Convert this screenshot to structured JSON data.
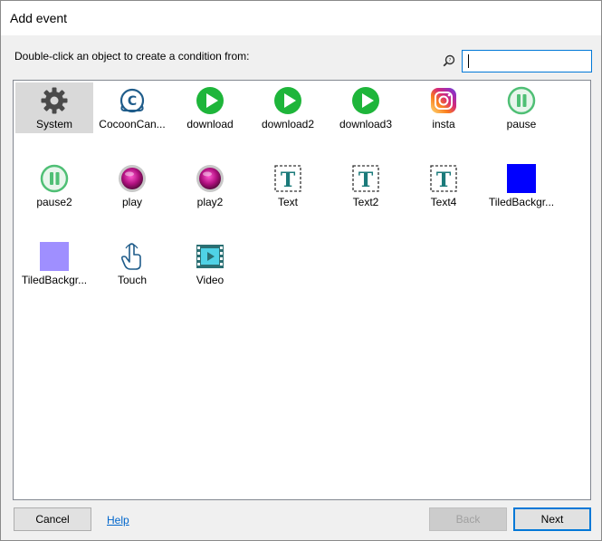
{
  "window": {
    "title": "Add event",
    "instruction": "Double-click an object to create a condition from:",
    "search": {
      "value": "",
      "placeholder": ""
    }
  },
  "objects": [
    {
      "label": "System",
      "icon": "gear-icon",
      "selected": true
    },
    {
      "label": "CocoonCan...",
      "icon": "cocoon-icon"
    },
    {
      "label": "download",
      "icon": "play-green-icon"
    },
    {
      "label": "download2",
      "icon": "play-green-icon"
    },
    {
      "label": "download3",
      "icon": "play-green-icon"
    },
    {
      "label": "insta",
      "icon": "instagram-icon"
    },
    {
      "label": "pause",
      "icon": "pause-icon"
    },
    {
      "label": "pause2",
      "icon": "pause-icon"
    },
    {
      "label": "play",
      "icon": "magenta-orb-icon"
    },
    {
      "label": "play2",
      "icon": "magenta-orb-icon"
    },
    {
      "label": "Text",
      "icon": "text-object-icon"
    },
    {
      "label": "Text2",
      "icon": "text-object-icon"
    },
    {
      "label": "Text4",
      "icon": "text-object-icon"
    },
    {
      "label": "TiledBackgr...",
      "icon": "blue-square-icon"
    },
    {
      "label": "TiledBackgr...",
      "icon": "purple-square-icon"
    },
    {
      "label": "Touch",
      "icon": "touch-hand-icon"
    },
    {
      "label": "Video",
      "icon": "video-icon"
    }
  ],
  "buttons": {
    "cancel": "Cancel",
    "help": "Help",
    "back": "Back",
    "next": "Next"
  },
  "colors": {
    "accent": "#0078d7",
    "green": "#1eb53a",
    "blue_square": "#0000ff",
    "purple_square": "#9f8fff"
  }
}
